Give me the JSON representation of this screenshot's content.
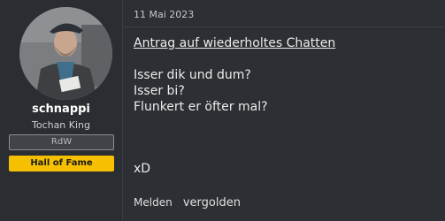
{
  "user": {
    "name": "schnappi",
    "title": "Tochan King",
    "banners": [
      {
        "label": "RdW"
      },
      {
        "label": "Hall of Fame"
      }
    ]
  },
  "post": {
    "date": "11 Mai 2023",
    "subject": "Antrag auf wiederholtes Chatten",
    "lines": [
      "Isser dik und dum?",
      "Isser bi?",
      "Flunkert er öfter mal?"
    ],
    "closing": "xD",
    "actions": {
      "report": "Melden",
      "gild": "vergolden"
    }
  },
  "colors": {
    "background": "#2c2f33",
    "banner_hof": "#f5c000",
    "banner_rdw_border": "#8b8f94"
  }
}
